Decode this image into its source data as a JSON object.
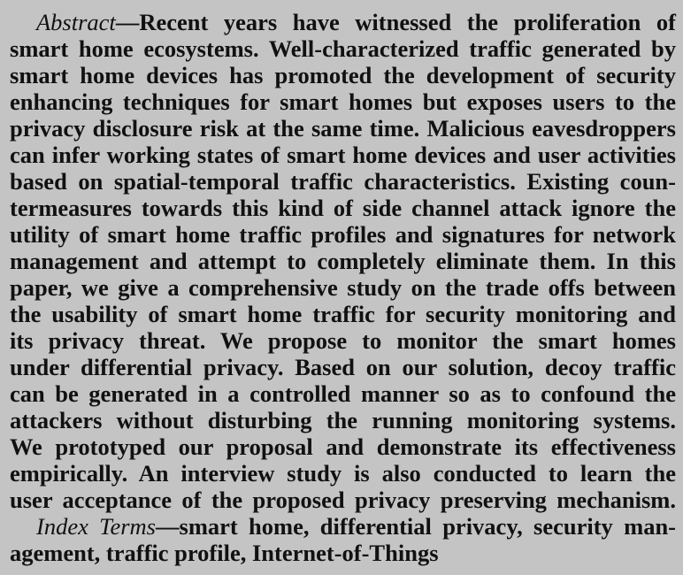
{
  "abstract": {
    "label": "Abstract",
    "dash": "—",
    "lines": [
      "Recent years have witnessed the proliferation of",
      "smart home ecosystems. Well-characterized traffic generated by",
      "smart home devices has promoted the development of security",
      "enhancing techniques for smart homes but exposes users to the",
      "privacy disclosure risk at the same time. Malicious eavesdroppers",
      "can infer working states of smart home devices and user activities",
      "based on spatial-temporal traffic characteristics. Existing coun-",
      "termeasures towards this kind of side channel attack ignore the",
      "utility of smart home traffic profiles and signatures for network",
      "management and attempt to completely eliminate them. In this",
      "paper, we give a comprehensive study on the trade offs between",
      "the usability of smart home traffic for security monitoring and",
      "its privacy threat. We propose to monitor the smart homes",
      "under differential privacy. Based on our solution, decoy traffic",
      "can be generated in a controlled manner so as to confound the",
      "attackers without disturbing the running monitoring systems.",
      "We prototyped our proposal and demonstrate its effectiveness",
      "empirically. An interview study is also conducted to learn the",
      "user acceptance of the proposed privacy preserving mechanism."
    ]
  },
  "index_terms": {
    "label": "Index Terms",
    "dash": "—",
    "lines": [
      "smart home, differential privacy, security man-",
      "agement, traffic profile, Internet-of-Things"
    ]
  }
}
